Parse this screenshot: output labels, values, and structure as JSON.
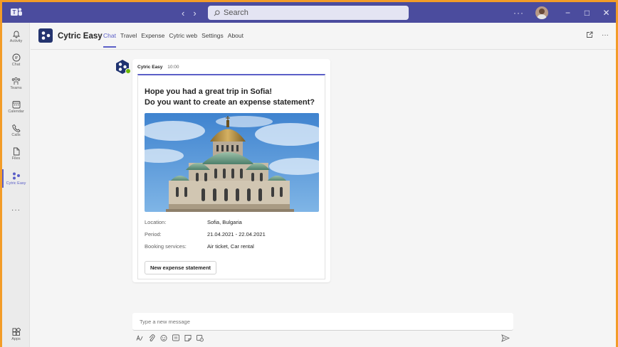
{
  "window": {
    "search_placeholder": "Search",
    "more_label": "···",
    "minimize": "−",
    "maximize": "□",
    "close": "✕",
    "back": "‹",
    "forward": "›"
  },
  "rail": {
    "items": [
      {
        "label": "Activity"
      },
      {
        "label": "Chat"
      },
      {
        "label": "Teams"
      },
      {
        "label": "Calendar"
      },
      {
        "label": "Calls"
      },
      {
        "label": "Files"
      },
      {
        "label": "Cytric Easy"
      },
      {
        "label": "Apps"
      }
    ],
    "more_label": "···"
  },
  "app": {
    "name": "Cytric Easy",
    "tabs": [
      "Chat",
      "Travel",
      "Expense",
      "Cytric web",
      "Settings",
      "About"
    ],
    "active_tab": "Chat",
    "more_label": "···"
  },
  "message": {
    "sender": "Cytric Easy",
    "time": "10:00",
    "card": {
      "title_line1": "Hope you had a great trip in Sofia!",
      "title_line2": "Do you want to create an expense statement?",
      "image": "cathedral-photo",
      "facts": [
        {
          "key": "Location:",
          "value": "Sofia, Bulgaria"
        },
        {
          "key": "Period:",
          "value": "21.04.2021 - 22.04.2021"
        },
        {
          "key": "Booking services:",
          "value": "Air ticket, Car rental"
        }
      ],
      "button": "New expense statement"
    }
  },
  "compose": {
    "placeholder": "Type a new message"
  },
  "colors": {
    "titlebar": "#4b4c9e",
    "accent": "#5b5fc7",
    "border": "#f39c28",
    "presence": "#6bb700"
  }
}
